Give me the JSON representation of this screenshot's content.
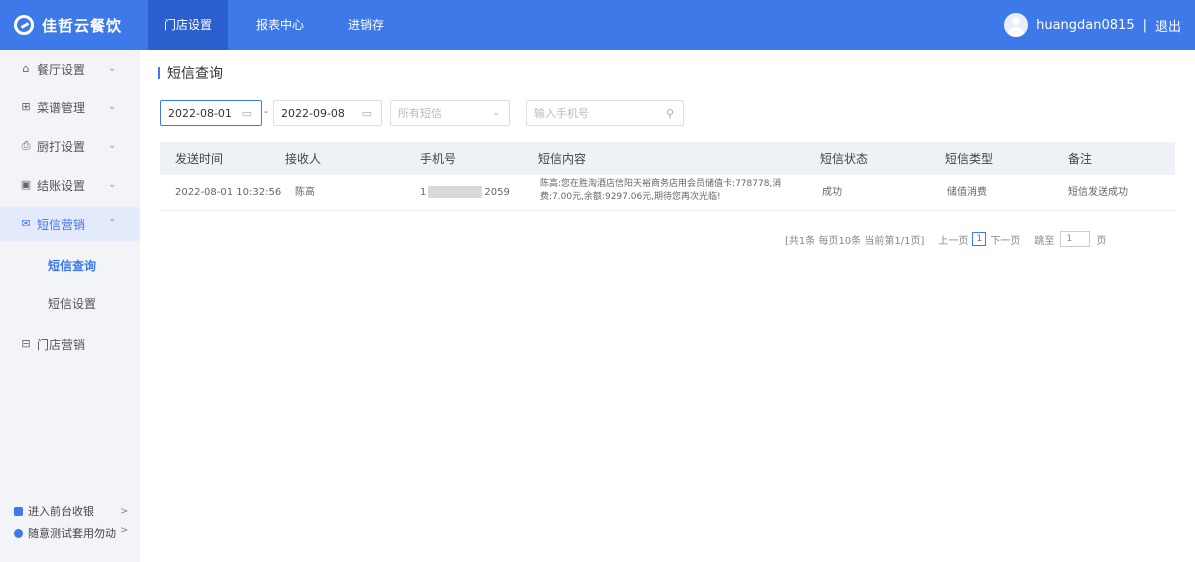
{
  "header": {
    "logo_text": "佳哲云餐饮",
    "tabs": [
      {
        "label": "门店设置",
        "active": true
      },
      {
        "label": "报表中心",
        "active": false
      },
      {
        "label": "进销存",
        "active": false
      }
    ],
    "username": "huangdan0815",
    "separator": "|",
    "logout": "退出"
  },
  "sidebar": {
    "items": [
      {
        "label": "餐厅设置",
        "icon": "home-icon",
        "chevron": "⌄"
      },
      {
        "label": "菜谱管理",
        "icon": "grid-icon",
        "chevron": "⌄"
      },
      {
        "label": "厨打设置",
        "icon": "printer-icon",
        "chevron": "⌄"
      },
      {
        "label": "结账设置",
        "icon": "receipt-icon",
        "chevron": "⌄"
      },
      {
        "label": "短信营销",
        "icon": "mail-icon",
        "chevron": "⌃"
      },
      {
        "label": "门店营销",
        "icon": "store-icon",
        "chevron": ""
      }
    ],
    "subitems": [
      {
        "label": "短信查询"
      },
      {
        "label": "短信设置"
      }
    ],
    "bottom": [
      {
        "label": "进入前台收银",
        "chevron": ">"
      },
      {
        "label": "随意测试套用勿动",
        "chevron": ">"
      }
    ]
  },
  "main": {
    "title": "短信查询",
    "filters": {
      "date_start": "2022-08-01",
      "date_end": "2022-09-08",
      "sms_type": "所有短信",
      "phone_placeholder": "输入手机号"
    },
    "table": {
      "headers": [
        "发送时间",
        "接收人",
        "手机号",
        "短信内容",
        "短信状态",
        "短信类型",
        "备注"
      ],
      "rows": [
        {
          "time": "2022-08-01 10:32:56",
          "receiver": "陈高",
          "phone_prefix": "1",
          "phone_suffix": "2059",
          "content_line1": "陈高:您在胜淘酒店信阳天裕商务店用会员储值卡:778778,消",
          "content_line2": "费:7.00元,余额:9297.06元,期待您再次光临!",
          "status": "成功",
          "type": "储值消费",
          "remark": "短信发送成功"
        }
      ]
    },
    "pager": {
      "summary": "[共1条 每页10条 当前第1/1页]",
      "prev": "上一页",
      "current": "1",
      "next": "下一页",
      "goto": "跳至",
      "goto_value": "1",
      "page_suffix": "页"
    }
  },
  "colors": {
    "brand": "#3e79ea",
    "sidebar_bg": "#f2f4f7",
    "table_header_bg": "#eef1f6"
  }
}
